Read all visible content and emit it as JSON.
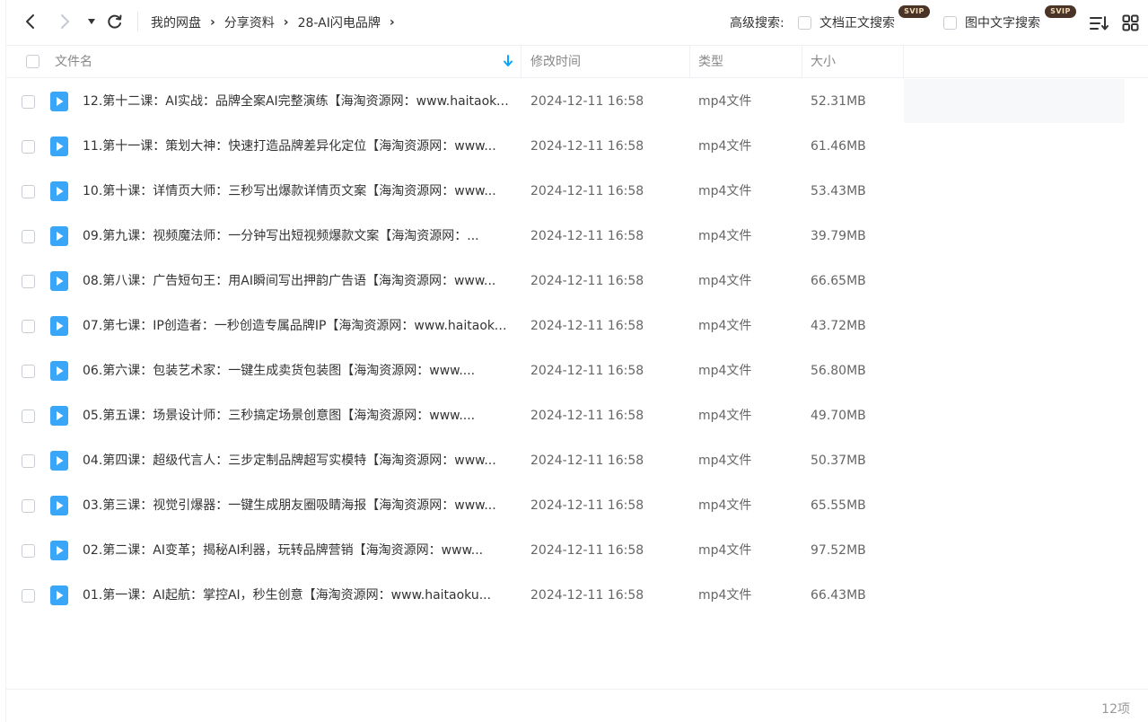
{
  "breadcrumb": [
    "我的网盘",
    "分享资料",
    "28-AI闪电品牌"
  ],
  "advanced_search": {
    "label": "高级搜索:",
    "doc_search": "文档正文搜索",
    "image_search": "图中文字搜索",
    "badge": "SVIP"
  },
  "columns": {
    "name": "文件名",
    "time": "修改时间",
    "type": "类型",
    "size": "大小"
  },
  "files": [
    {
      "name": "12.第十二课：AI实战：品牌全案AI完整演练【海淘资源网：www.haitaoku...",
      "time": "2024-12-11 16:58",
      "type": "mp4文件",
      "size": "52.31MB"
    },
    {
      "name": "11.第十一课：策划大神：快速打造品牌差异化定位【海淘资源网：www...",
      "time": "2024-12-11 16:58",
      "type": "mp4文件",
      "size": "61.46MB"
    },
    {
      "name": "10.第十课：详情页大师：三秒写出爆款详情页文案【海淘资源网：www...",
      "time": "2024-12-11 16:58",
      "type": "mp4文件",
      "size": "53.43MB"
    },
    {
      "name": "09.第九课：视频魔法师：一分钟写出短视频爆款文案【海淘资源网：...",
      "time": "2024-12-11 16:58",
      "type": "mp4文件",
      "size": "39.79MB"
    },
    {
      "name": "08.第八课：广告短句王：用AI瞬间写出押韵广告语【海淘资源网：www...",
      "time": "2024-12-11 16:58",
      "type": "mp4文件",
      "size": "66.65MB"
    },
    {
      "name": "07.第七课：IP创造者：一秒创造专属品牌IP【海淘资源网：www.haitaoku...",
      "time": "2024-12-11 16:58",
      "type": "mp4文件",
      "size": "43.72MB"
    },
    {
      "name": "06.第六课：包装艺术家：一键生成卖货包装图【海淘资源网：www....",
      "time": "2024-12-11 16:58",
      "type": "mp4文件",
      "size": "56.80MB"
    },
    {
      "name": "05.第五课：场景设计师：三秒搞定场景创意图【海淘资源网：www....",
      "time": "2024-12-11 16:58",
      "type": "mp4文件",
      "size": "49.70MB"
    },
    {
      "name": "04.第四课：超级代言人：三步定制品牌超写实模特【海淘资源网：www...",
      "time": "2024-12-11 16:58",
      "type": "mp4文件",
      "size": "50.37MB"
    },
    {
      "name": "03.第三课：视觉引爆器：一键生成朋友圈吸睛海报【海淘资源网：www...",
      "time": "2024-12-11 16:58",
      "type": "mp4文件",
      "size": "65.55MB"
    },
    {
      "name": "02.第二课：AI变革；揭秘AI利器，玩转品牌营销【海淘资源网：www...",
      "time": "2024-12-11 16:58",
      "type": "mp4文件",
      "size": "97.52MB"
    },
    {
      "name": "01.第一课：AI起航：掌控AI，秒生创意【海淘资源网：www.haitaoku...",
      "time": "2024-12-11 16:58",
      "type": "mp4文件",
      "size": "66.43MB"
    }
  ],
  "footer": {
    "count": "12项"
  },
  "colors": {
    "accent": "#06a7ff",
    "video_icon": "#3aa6f7",
    "svip_bg": "#4a3428"
  }
}
